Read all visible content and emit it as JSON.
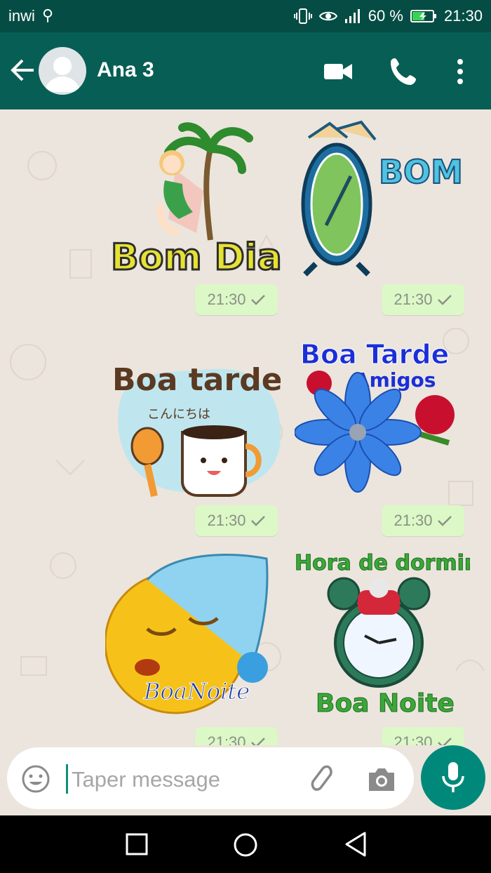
{
  "status_bar": {
    "carrier": "inwi",
    "battery_percent": "60 %",
    "time": "21:30"
  },
  "header": {
    "back_icon": "arrow-left-icon",
    "contact_name": "Ana 3",
    "video_icon": "video-call-icon",
    "call_icon": "phone-icon",
    "menu_icon": "more-vert-icon"
  },
  "messages": [
    {
      "sticker": "Bom Dia",
      "time": "21:30",
      "status": "sent"
    },
    {
      "sticker": "BOM DIA",
      "time": "21:30",
      "status": "sent"
    },
    {
      "sticker": "Boa tarde",
      "sub": "こんにちは",
      "time": "21:30",
      "status": "sent"
    },
    {
      "sticker": "Boa Tarde",
      "sub": "Amigos",
      "time": "21:30",
      "status": "sent"
    },
    {
      "sticker": "BoaNoite",
      "time": "21:30",
      "status": "sent"
    },
    {
      "sticker": "Hora de dormir",
      "sub": "Boa Noite",
      "time": "21:30",
      "status": "sent"
    }
  ],
  "composer": {
    "placeholder": "Taper message",
    "emoji_icon": "emoji-icon",
    "attach_icon": "paperclip-icon",
    "camera_icon": "camera-icon",
    "mic_icon": "microphone-icon"
  },
  "colors": {
    "header": "#075e54",
    "status_bar": "#054d44",
    "bubble": "#dcf8c6",
    "chat_bg": "#ece5dd",
    "accent": "#00897b"
  }
}
